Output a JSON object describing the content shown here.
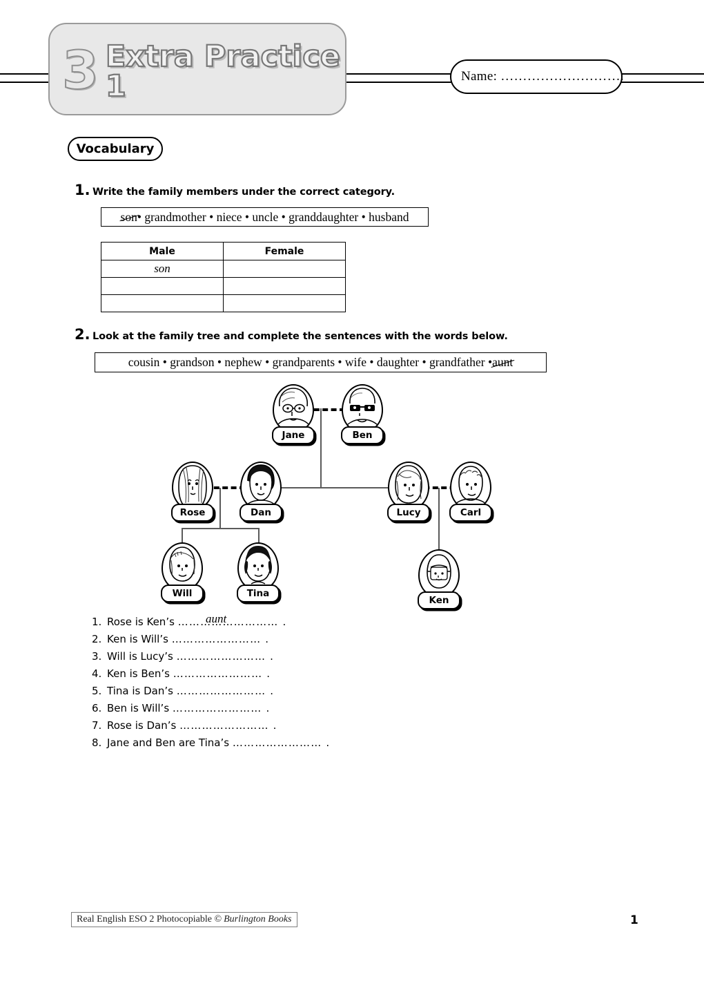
{
  "header": {
    "unit_number": "3",
    "title": "Extra Practice 1",
    "name_label": "Name: ……………………….",
    "section_tag": "Vocabulary"
  },
  "exercises": [
    {
      "number": "1.",
      "instruction": "Write the family members under the correct category.",
      "wordbank": {
        "crossed_word": "son",
        "separator": " • ",
        "words": [
          "grandmother",
          "niece",
          "uncle",
          "granddaughter",
          "husband"
        ],
        "full_text": "son • grandmother • niece • uncle • granddaughter • husband"
      },
      "table": {
        "headers": [
          "Male",
          "Female"
        ],
        "rows": [
          [
            "son",
            ""
          ],
          [
            "",
            ""
          ],
          [
            "",
            ""
          ]
        ]
      }
    },
    {
      "number": "2.",
      "instruction": "Look at the family tree and complete the sentences with the words below.",
      "wordbank": {
        "words": [
          "cousin",
          "grandson",
          "nephew",
          "grandparents",
          "wife",
          "daughter",
          "grandfather"
        ],
        "crossed_word": "aunt",
        "separator": " • ",
        "full_text": "cousin • grandson • nephew • grandparents • wife • daughter • grandfather • aunt"
      },
      "family_tree": {
        "generation_1": [
          "Jane",
          "Ben"
        ],
        "generation_2": [
          "Rose",
          "Dan",
          "Lucy",
          "Carl"
        ],
        "generation_3": [
          "Will",
          "Tina",
          "Ken"
        ],
        "marriages": [
          [
            "Jane",
            "Ben"
          ],
          [
            "Rose",
            "Dan"
          ],
          [
            "Lucy",
            "Carl"
          ]
        ],
        "children": {
          "Jane+Ben": [
            "Dan",
            "Lucy"
          ],
          "Rose+Dan": [
            "Will",
            "Tina"
          ],
          "Lucy+Carl": [
            "Ken"
          ]
        },
        "labels": {
          "jane": "Jane",
          "ben": "Ben",
          "rose": "Rose",
          "dan": "Dan",
          "lucy": "Lucy",
          "carl": "Carl",
          "will": "Will",
          "tina": "Tina",
          "ken": "Ken"
        }
      },
      "sentences": [
        {
          "number": "1.",
          "text": "Rose is Ken’s",
          "dots": "………………………",
          "answer": "aunt",
          "end": "."
        },
        {
          "number": "2.",
          "text": "Ken is Will’s",
          "dots": "……………………",
          "answer": "",
          "end": "."
        },
        {
          "number": "3.",
          "text": "Will is Lucy’s",
          "dots": "……………………",
          "answer": "",
          "end": "."
        },
        {
          "number": "4.",
          "text": "Ken is Ben’s",
          "dots": "……………………",
          "answer": "",
          "end": "."
        },
        {
          "number": "5.",
          "text": "Tina is Dan’s",
          "dots": "……………………",
          "answer": "",
          "end": "."
        },
        {
          "number": "6.",
          "text": "Ben is Will’s",
          "dots": "……………………",
          "answer": "",
          "end": "."
        },
        {
          "number": "7.",
          "text": "Rose is Dan’s",
          "dots": "……………………",
          "answer": "",
          "end": "."
        },
        {
          "number": "8.",
          "text": "Jane and Ben are Tina’s",
          "dots": "……………………",
          "answer": "",
          "end": "."
        }
      ]
    }
  ],
  "footer": {
    "credit_main": "Real English ESO 2 Photocopiable ©",
    "credit_publisher": "Burlington Books",
    "page_number": "1"
  },
  "colors": {
    "banner_fill": "#e8e8e8",
    "banner_stroke": "#9a9a9a",
    "ink": "#000000",
    "tree_line": "#5a5a5a"
  }
}
